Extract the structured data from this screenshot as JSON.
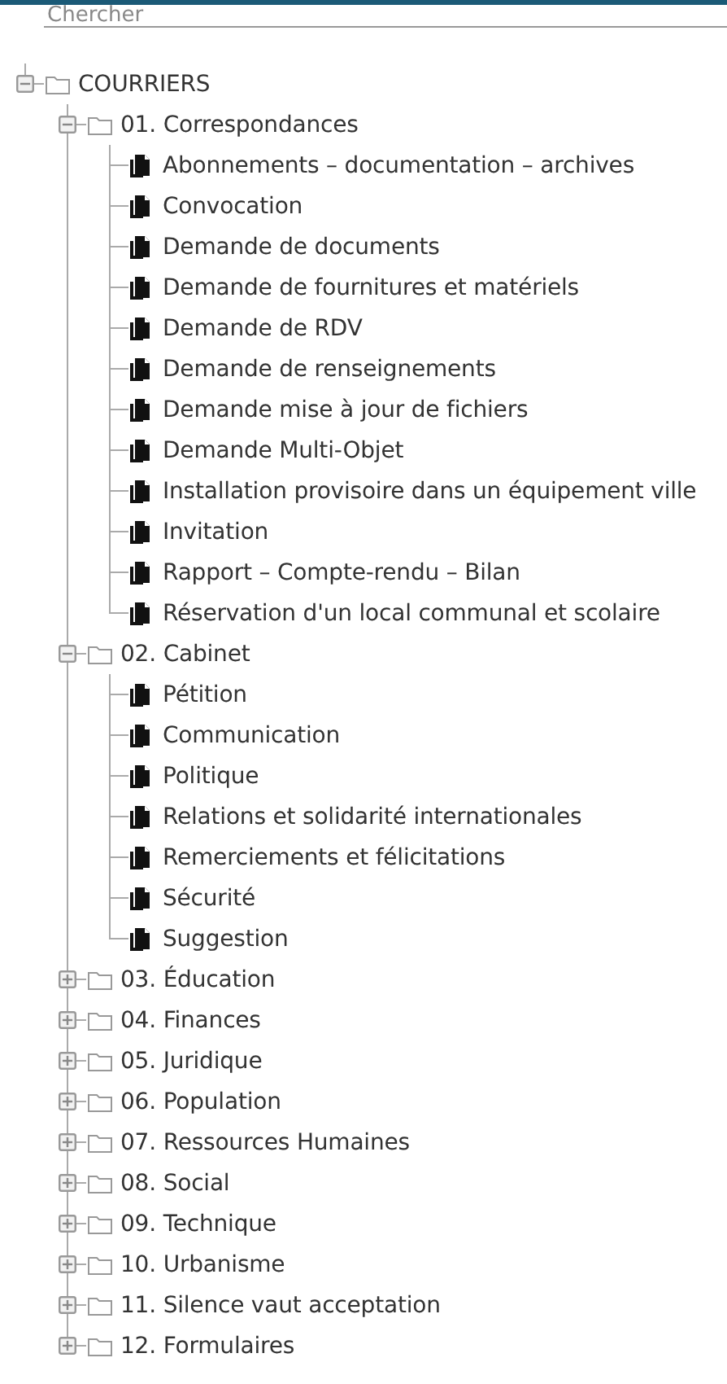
{
  "search": {
    "placeholder": "Chercher"
  },
  "tree": [
    {
      "kind": "folder",
      "label": "COURRIERS",
      "expanded": true,
      "children": [
        {
          "kind": "folder",
          "label": "01. Correspondances",
          "expanded": true,
          "children": [
            {
              "kind": "document",
              "label": "Abonnements – documentation – archives"
            },
            {
              "kind": "document",
              "label": "Convocation"
            },
            {
              "kind": "document",
              "label": "Demande de documents"
            },
            {
              "kind": "document",
              "label": "Demande de fournitures et matériels"
            },
            {
              "kind": "document",
              "label": "Demande de RDV"
            },
            {
              "kind": "document",
              "label": "Demande de renseignements"
            },
            {
              "kind": "document",
              "label": "Demande mise à jour de fichiers"
            },
            {
              "kind": "document",
              "label": "Demande Multi-Objet"
            },
            {
              "kind": "document",
              "label": "Installation provisoire dans un équipement ville"
            },
            {
              "kind": "document",
              "label": "Invitation"
            },
            {
              "kind": "document",
              "label": "Rapport – Compte-rendu – Bilan"
            },
            {
              "kind": "document",
              "label": "Réservation d'un local communal et scolaire"
            }
          ]
        },
        {
          "kind": "folder",
          "label": "02. Cabinet",
          "expanded": true,
          "children": [
            {
              "kind": "document",
              "label": "Pétition"
            },
            {
              "kind": "document",
              "label": "Communication"
            },
            {
              "kind": "document",
              "label": "Politique"
            },
            {
              "kind": "document",
              "label": "Relations et solidarité internationales"
            },
            {
              "kind": "document",
              "label": "Remerciements et félicitations"
            },
            {
              "kind": "document",
              "label": "Sécurité"
            },
            {
              "kind": "document",
              "label": "Suggestion"
            }
          ]
        },
        {
          "kind": "folder",
          "label": "03. Éducation",
          "expanded": false
        },
        {
          "kind": "folder",
          "label": "04. Finances",
          "expanded": false
        },
        {
          "kind": "folder",
          "label": "05. Juridique",
          "expanded": false
        },
        {
          "kind": "folder",
          "label": "06. Population",
          "expanded": false
        },
        {
          "kind": "folder",
          "label": "07. Ressources Humaines",
          "expanded": false
        },
        {
          "kind": "folder",
          "label": "08. Social",
          "expanded": false
        },
        {
          "kind": "folder",
          "label": "09. Technique",
          "expanded": false
        },
        {
          "kind": "folder",
          "label": "10. Urbanisme",
          "expanded": false
        },
        {
          "kind": "folder",
          "label": "11. Silence vaut acceptation",
          "expanded": false
        },
        {
          "kind": "folder",
          "label": "12. Formulaires",
          "expanded": false
        }
      ]
    }
  ]
}
